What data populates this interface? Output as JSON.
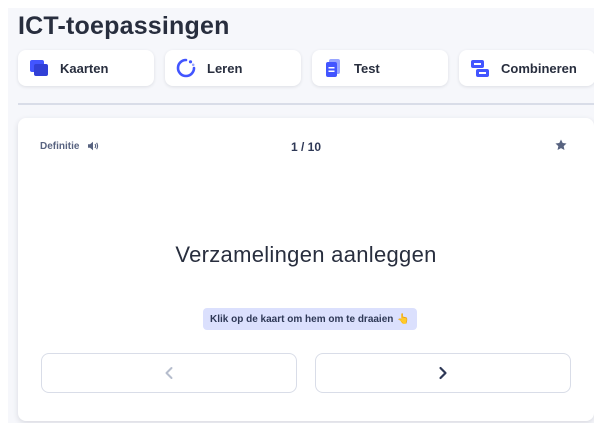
{
  "set_title": "ICT-toepassingen",
  "modes": [
    {
      "label": "Kaarten",
      "icon": "flashcards-icon"
    },
    {
      "label": "Leren",
      "icon": "learn-cycle-icon"
    },
    {
      "label": "Test",
      "icon": "test-document-icon"
    },
    {
      "label": "Combineren",
      "icon": "match-icon"
    }
  ],
  "card": {
    "side_label": "Definitie",
    "audio_icon": "speaker-icon",
    "counter": "1 / 10",
    "star_icon": "star-icon",
    "term": "Verzamelingen aanleggen",
    "hint": "Klik op de kaart om hem om te draaien",
    "hint_emoji": "👆",
    "prev_icon": "chevron-left-icon",
    "next_icon": "chevron-right-icon"
  },
  "colors": {
    "accent": "#4255ff",
    "accent_light": "#dbe0fd",
    "text": "#282e3e",
    "muted": "#586380",
    "background": "#f6f7fb"
  }
}
